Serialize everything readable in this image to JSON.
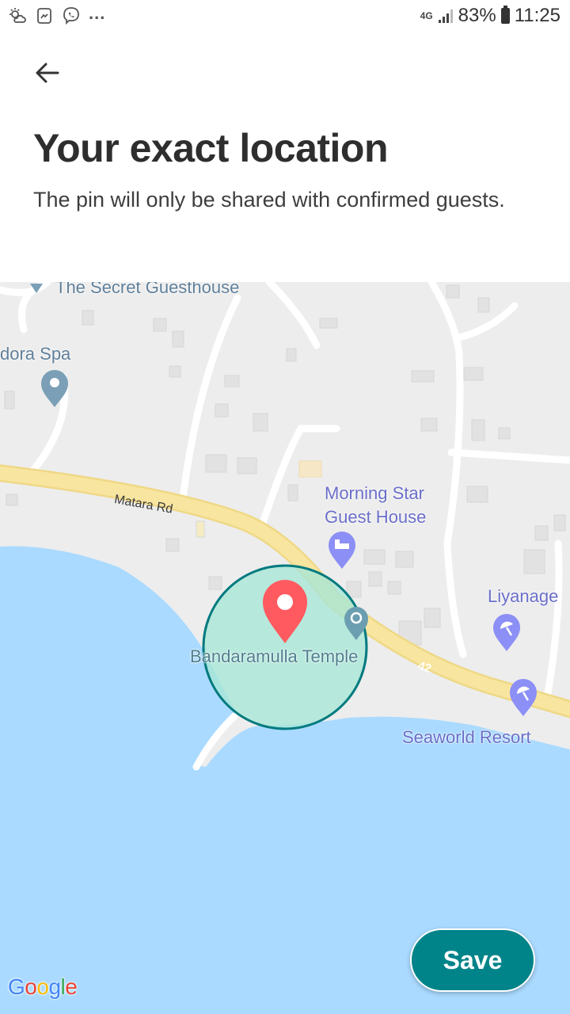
{
  "status_bar": {
    "network": "4G",
    "battery": "83%",
    "time": "11:25",
    "more": "..."
  },
  "header": {
    "title": "Your exact location",
    "subtitle": "The pin will only be shared with confirmed guests."
  },
  "map": {
    "labels": {
      "secret_guesthouse": "The Secret Guesthouse",
      "dora_spa": "dora Spa",
      "matara_rd": "Matara Rd",
      "morning_star_line1": "Morning Star",
      "morning_star_line2": "Guest House",
      "liyanage": "Liyanage",
      "bandaramulla_temple": "Bandaramulla Temple",
      "seaworld_resort": "Seaworld Resort",
      "highway_number": "42"
    },
    "colors": {
      "land": "#eeeeee",
      "water": "#aadaff",
      "road": "#f9e6a0",
      "circle_fill": "#a8e6d6",
      "circle_stroke": "#007a7f",
      "pin": "#ff5a5f",
      "poi_blue": "#8c8ff5",
      "poi_teal": "#6a9eb0"
    }
  },
  "actions": {
    "save_label": "Save"
  },
  "attribution": {
    "google": [
      "G",
      "o",
      "o",
      "g",
      "l",
      "e"
    ]
  }
}
